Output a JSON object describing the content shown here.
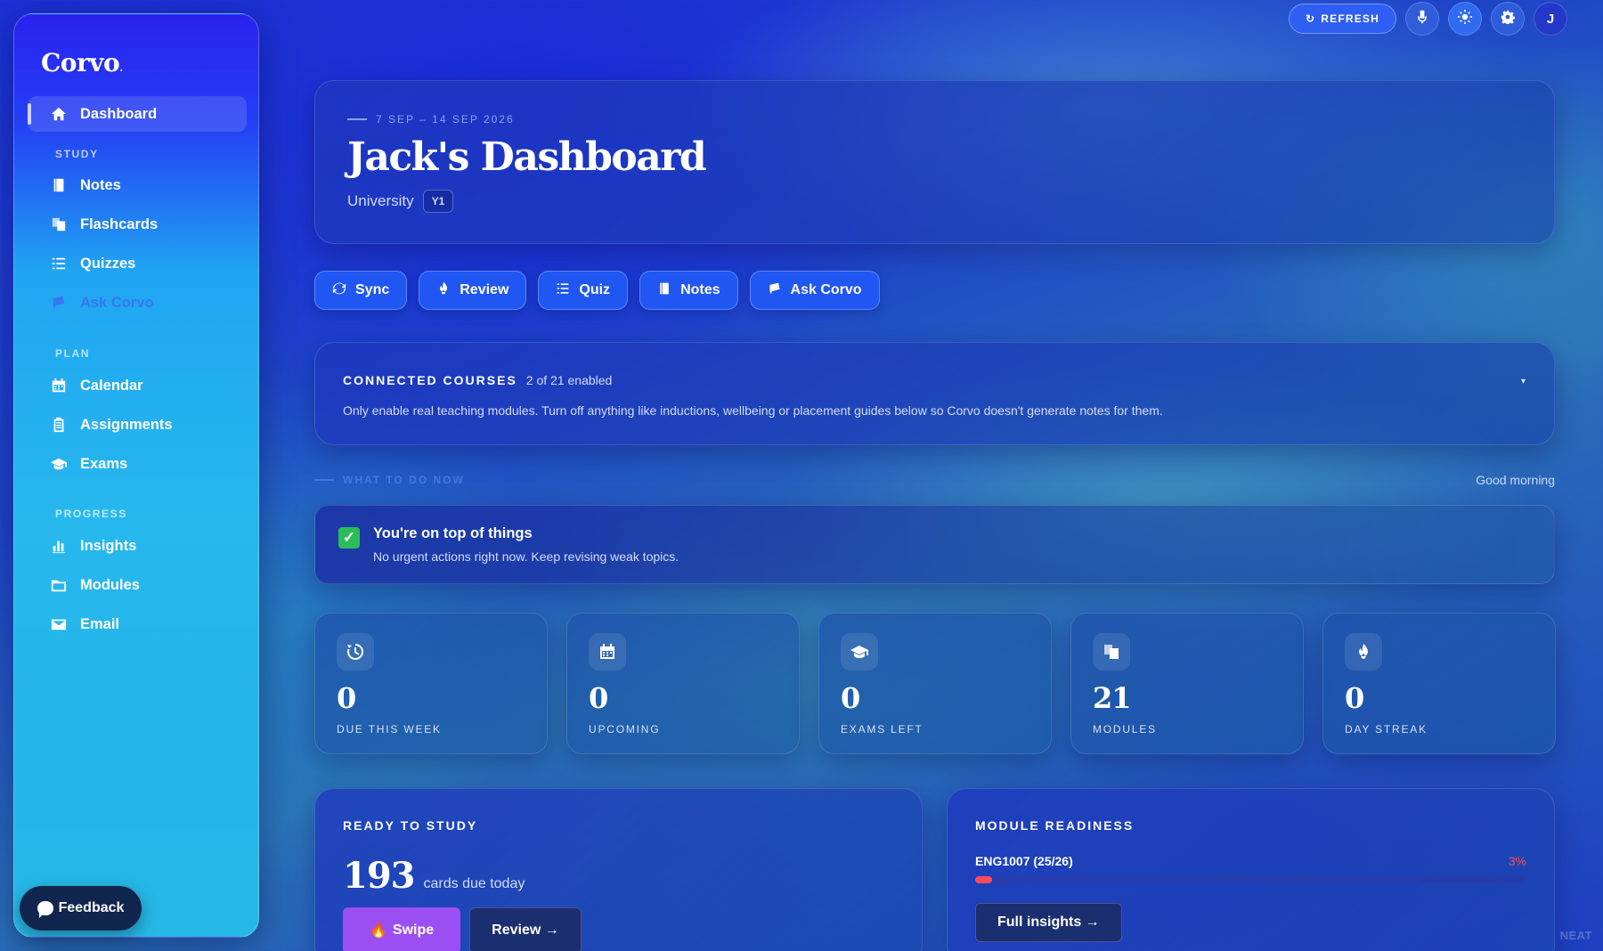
{
  "app": {
    "logo": "Corvo",
    "logo_dot": "."
  },
  "sidebar": {
    "items": [
      {
        "label": "Dashboard",
        "icon": "home-icon"
      },
      {
        "label": "Notes",
        "icon": "note-icon"
      },
      {
        "label": "Flashcards",
        "icon": "flashcards-icon"
      },
      {
        "label": "Quizzes",
        "icon": "list-icon"
      },
      {
        "label": "Ask Corvo",
        "icon": "chat-icon"
      },
      {
        "label": "Calendar",
        "icon": "calendar-icon"
      },
      {
        "label": "Assignments",
        "icon": "clipboard-icon"
      },
      {
        "label": "Exams",
        "icon": "graduation-cap-icon"
      },
      {
        "label": "Insights",
        "icon": "bar-chart-icon"
      },
      {
        "label": "Modules",
        "icon": "folder-icon"
      },
      {
        "label": "Email",
        "icon": "mail-icon"
      }
    ],
    "sections": {
      "study": "STUDY",
      "plan": "PLAN",
      "progress": "PROGRESS"
    },
    "feedback_label": "Feedback"
  },
  "topbar": {
    "refresh_label": "REFRESH",
    "avatar_initial": "J"
  },
  "hero": {
    "date_range": "7 SEP – 14 SEP 2026",
    "title": "Jack's Dashboard",
    "level": "University",
    "year": "Y1"
  },
  "actions": [
    {
      "label": "Sync",
      "icon": "sync-icon"
    },
    {
      "label": "Review",
      "icon": "fire-icon"
    },
    {
      "label": "Quiz",
      "icon": "list-icon"
    },
    {
      "label": "Notes",
      "icon": "note-icon"
    },
    {
      "label": "Ask Corvo",
      "icon": "chat-icon"
    }
  ],
  "courses": {
    "title": "CONNECTED COURSES",
    "count": "2 of 21 enabled",
    "description": "Only enable real teaching modules. Turn off anything like inductions, wellbeing or placement guides below so Corvo doesn't generate notes for them.",
    "caret": "▾"
  },
  "todo": {
    "label": "WHAT TO DO NOW",
    "greeting": "Good morning"
  },
  "status": {
    "title": "You're on top of things",
    "message": "No urgent actions right now. Keep revising weak topics."
  },
  "stats": [
    {
      "value": "0",
      "label": "DUE THIS WEEK",
      "icon": "clock-icon"
    },
    {
      "value": "0",
      "label": "UPCOMING",
      "icon": "calendar-icon"
    },
    {
      "value": "0",
      "label": "EXAMS LEFT",
      "icon": "graduation-cap-icon"
    },
    {
      "value": "21",
      "label": "MODULES",
      "icon": "flashcards-icon"
    },
    {
      "value": "0",
      "label": "DAY STREAK",
      "icon": "fire-icon"
    }
  ],
  "study": {
    "title": "READY TO STUDY",
    "count": "193",
    "count_label": "cards due today",
    "swipe_label": "Swipe",
    "swipe_emoji": "🔥",
    "review_label": "Review →"
  },
  "readiness": {
    "title": "MODULE READINESS",
    "module": "ENG1007 (25/26)",
    "percent_label": "3%",
    "percent": 3,
    "insights_label": "Full insights →"
  },
  "watermark": "NEAT",
  "colors": {
    "accent": "#2057f2",
    "danger": "#ff4a5a",
    "success": "#2bbd5a",
    "swipe": "#9b4ff2"
  }
}
